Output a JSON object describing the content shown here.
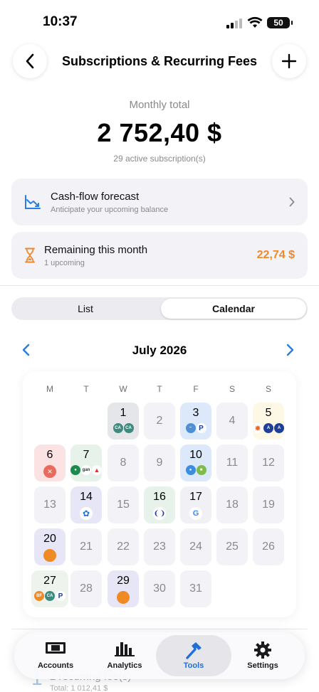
{
  "status": {
    "time": "10:37",
    "battery": "50"
  },
  "header": {
    "title": "Subscriptions & Recurring Fees",
    "back_icon": "chevron-left-icon",
    "add_icon": "plus-icon"
  },
  "summary": {
    "label": "Monthly total",
    "amount": "2 752,40 $",
    "active": "29 active subscription(s)"
  },
  "forecast": {
    "title": "Cash-flow forecast",
    "subtitle": "Anticipate your upcoming balance",
    "icon": "trend-down-chart-icon"
  },
  "remaining": {
    "title": "Remaining this month",
    "subtitle": "1 upcoming",
    "amount": "22,74 $",
    "icon": "hourglass-icon",
    "accent": "#f0882a"
  },
  "segments": {
    "list": "List",
    "calendar": "Calendar",
    "selected": "Calendar"
  },
  "calendar": {
    "month": "July 2026",
    "weekdays": [
      "M",
      "T",
      "W",
      "T",
      "F",
      "S",
      "S"
    ],
    "days": [
      "1",
      "2",
      "3",
      "4",
      "5",
      "6",
      "7",
      "8",
      "9",
      "10",
      "11",
      "12",
      "13",
      "14",
      "15",
      "16",
      "17",
      "18",
      "19",
      "20",
      "21",
      "22",
      "23",
      "24",
      "25",
      "26",
      "27",
      "28",
      "29",
      "30",
      "31"
    ]
  },
  "below": {
    "count": "1",
    "title": "2 recurring fee(s)",
    "sub": "Total: 1 012,41 $"
  },
  "tabbar": {
    "accounts": "Accounts",
    "analytics": "Analytics",
    "tools": "Tools",
    "settings": "Settings",
    "active": "Tools",
    "accent": "#1e6fd9"
  }
}
